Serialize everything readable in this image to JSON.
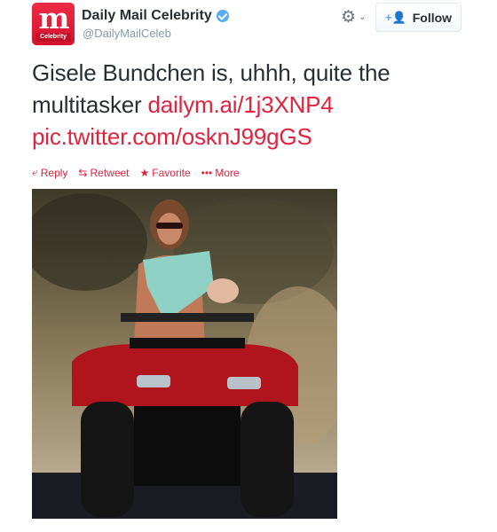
{
  "account": {
    "avatar_letter": "m",
    "avatar_tag": "Celebrity",
    "display_name": "Daily Mail Celebrity",
    "handle": "@DailyMailCeleb",
    "verified": true
  },
  "header": {
    "gear_icon": "gear-icon",
    "follow_label": "Follow"
  },
  "tweet": {
    "text": "Gisele Bundchen is, uhhh, quite the multitasker ",
    "link": "dailym.ai/1j3XNP4",
    "pic_link": "pic.twitter.com/osknJ99gGS"
  },
  "actions": [
    {
      "icon": "reply-icon",
      "label": "Reply"
    },
    {
      "icon": "retweet-icon",
      "label": "Retweet"
    },
    {
      "icon": "star-icon",
      "label": "Favorite"
    },
    {
      "icon": "more-icon",
      "label": "More"
    }
  ],
  "colors": {
    "accent": "#e0243f",
    "text": "#292f33",
    "muted": "#8899a6",
    "verified": "#55acee"
  },
  "media": {
    "description": "Woman in sunglasses breastfeeding a baby while riding a red ATV on a dirt road"
  }
}
